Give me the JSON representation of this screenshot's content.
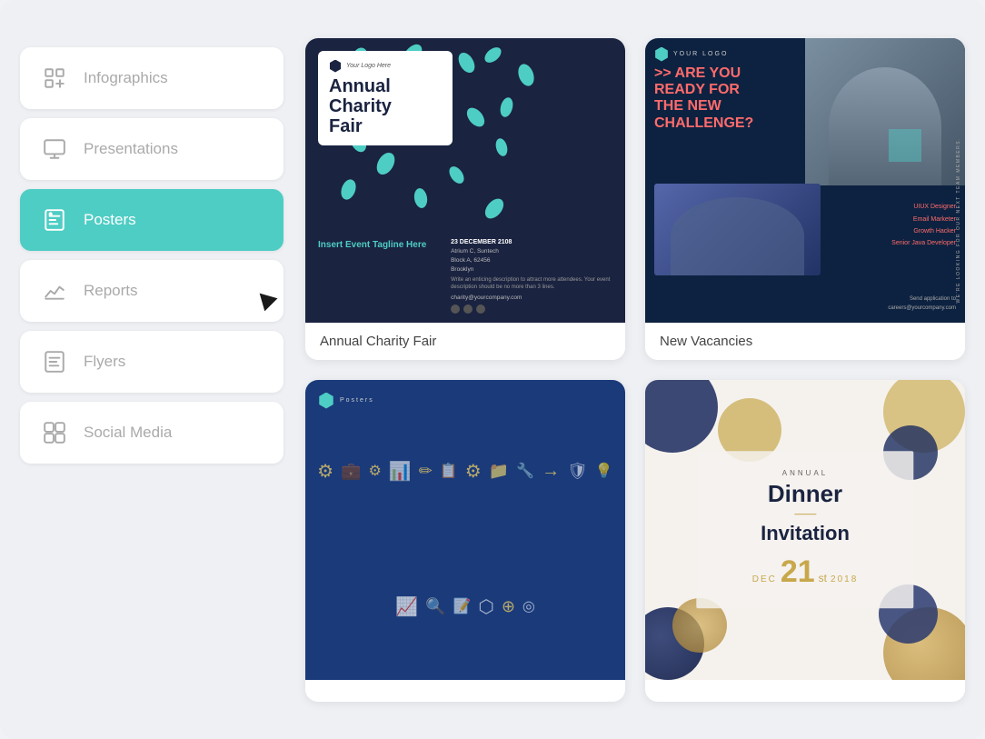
{
  "sidebar": {
    "items": [
      {
        "id": "infographics",
        "label": "Infographics",
        "active": false
      },
      {
        "id": "presentations",
        "label": "Presentations",
        "active": false
      },
      {
        "id": "posters",
        "label": "Posters",
        "active": true
      },
      {
        "id": "reports",
        "label": "Reports",
        "active": false
      },
      {
        "id": "flyers",
        "label": "Flyers",
        "active": false
      },
      {
        "id": "social-media",
        "label": "Social Media",
        "active": false
      }
    ]
  },
  "cards": [
    {
      "id": "charity-fair",
      "label": "Annual Charity Fair"
    },
    {
      "id": "new-vacancies",
      "label": "New Vacancies"
    },
    {
      "id": "tools-poster",
      "label": ""
    },
    {
      "id": "dinner-invitation",
      "label": ""
    }
  ],
  "charity": {
    "logo_text": "Your Logo Here",
    "title_line1": "Annual",
    "title_line2": "Charity",
    "title_line3": "Fair",
    "event_tagline": "Insert Event Tagline Here",
    "date": "23 DECEMBER 2108",
    "venue_line1": "Atrium C, Suntech",
    "venue_line2": "Block A, 62456",
    "venue_line3": "Brooklyn",
    "description": "Write an enticing description to attract more attendees. Your event description should be no more than 3 lines.",
    "email": "charity@yourcompany.com"
  },
  "vacancies": {
    "logo_text": "YOUR LOGO",
    "headline_line1": ">> ARE YOU",
    "headline_line2": "READY FOR",
    "headline_line3": "THE NEW",
    "headline_line4": "CHALLENGE?",
    "side_text": "WE'RE LOOKING FOR OUR NEXT TEAM MEMBERS.",
    "roles": [
      "UIUX Designer",
      "Email Marketer",
      "Growth Hacker",
      "Senior Java Developer"
    ],
    "send": "Send application to",
    "email": "careers@yourcompany.com"
  },
  "dinner": {
    "annual": "ANNUAL",
    "title": "Dinner",
    "invitation": "Invitation",
    "dec": "DEC",
    "day": "21",
    "st": "st",
    "year": "2018"
  },
  "colors": {
    "teal": "#4ecdc4",
    "dark_navy": "#1a2340",
    "coral": "#ff6b6b",
    "gold": "#c8a84b"
  }
}
